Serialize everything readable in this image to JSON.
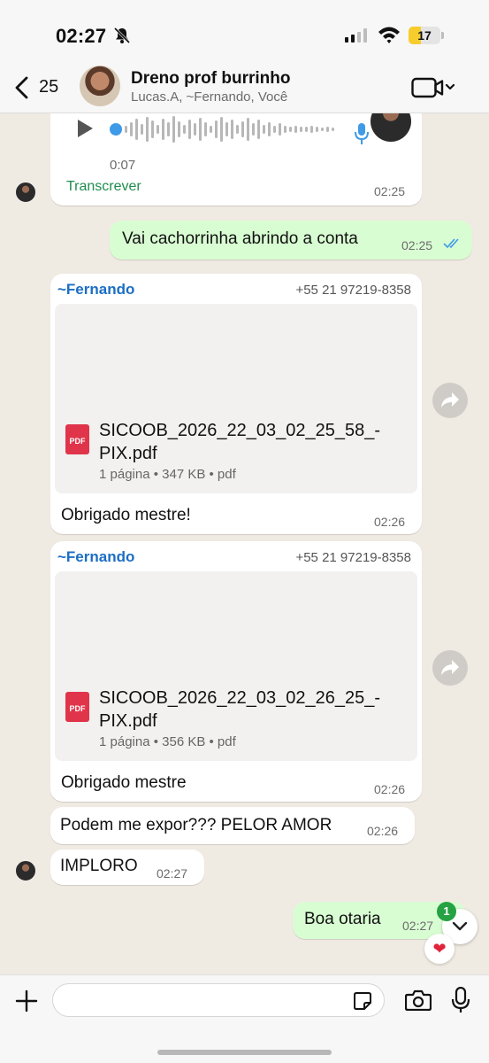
{
  "status": {
    "time": "02:27",
    "battery": "17"
  },
  "header": {
    "unread_count": "25",
    "title": "Dreno prof burrinho",
    "subtitle": "Lucas.A, ~Fernando, Você"
  },
  "audio": {
    "duration": "0:07",
    "transcribe": "Transcrever",
    "time": "02:25"
  },
  "messages": {
    "m1": {
      "text": "Vai cachorrinha abrindo a conta",
      "time": "02:25"
    },
    "m2": {
      "sender": "~Fernando",
      "phone": "+55 21 97219-8358",
      "file_name": "SICOOB_2026_22_03_02_25_58_-PIX.pdf",
      "file_meta": "1 página • 347 KB • pdf",
      "caption": "Obrigado mestre!",
      "time": "02:26"
    },
    "m3": {
      "sender": "~Fernando",
      "phone": "+55 21 97219-8358",
      "file_name": "SICOOB_2026_22_03_02_26_25_-PIX.pdf",
      "file_meta": "1 página • 356 KB • pdf",
      "caption": "Obrigado mestre",
      "time": "02:26"
    },
    "m4": {
      "text": "Podem me expor??? PELOR AMOR",
      "time": "02:26"
    },
    "m5": {
      "text": "IMPLORO",
      "time": "02:27"
    },
    "m6": {
      "text": "Boa otaria",
      "time": "02:27"
    }
  },
  "pdf_label": "PDF",
  "scroll_badge": "1",
  "reaction": "❤",
  "colors": {
    "accent": "#1c6ec4",
    "outgoing": "#d9fdd3",
    "pdf": "#e0344a",
    "badge": "#25a244"
  }
}
